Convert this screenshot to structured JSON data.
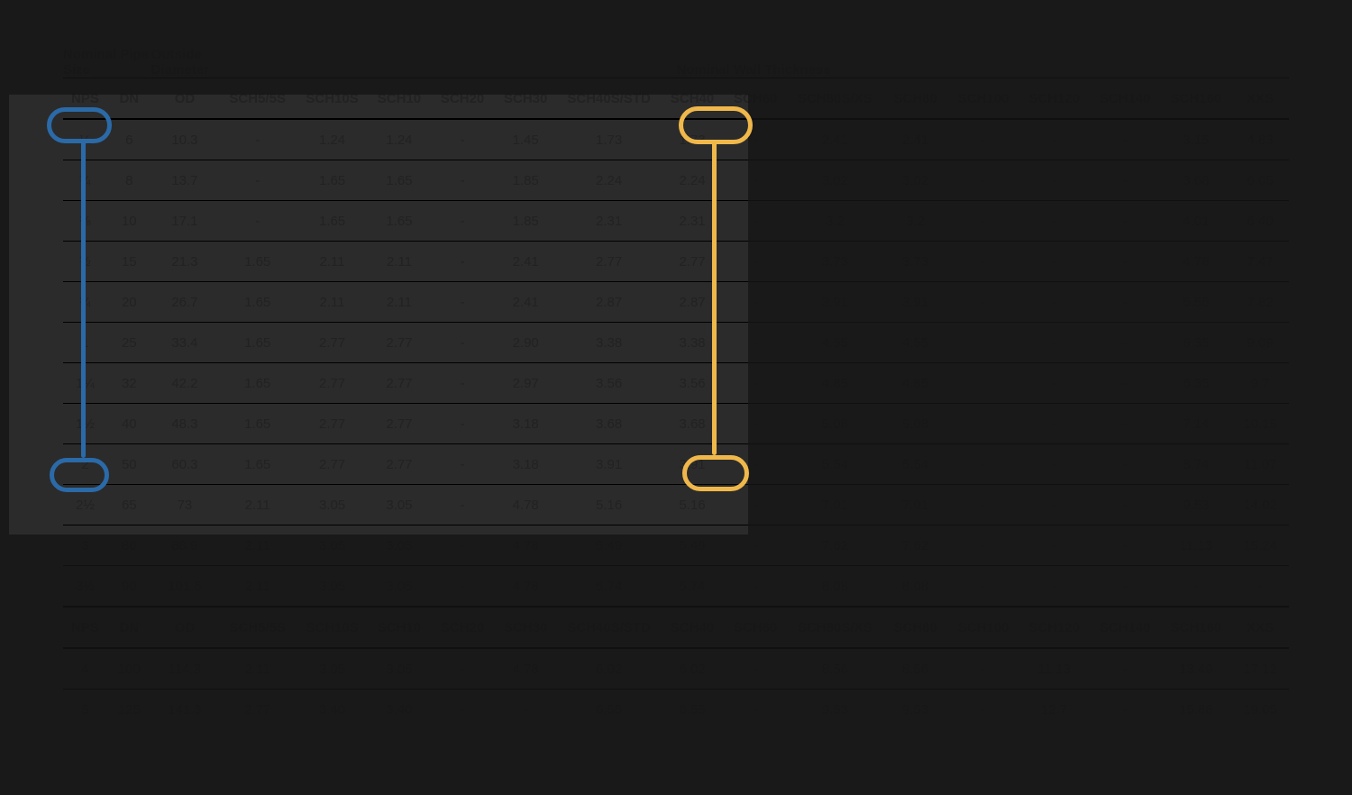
{
  "headers": {
    "group_nps": "Nominal Pipe Size",
    "group_od": "Outside Diameter",
    "group_thk": "Nominal Wall Thickness",
    "cols": [
      "NPS",
      "DN",
      "OD",
      "SCH5/5S",
      "SCH10S",
      "SCH10",
      "SCH20",
      "SCH30",
      "SCH40S/STD",
      "SCH40",
      "SCH60",
      "SCH80S/XS",
      "SCH80",
      "SCH100",
      "SCH120",
      "SCH140",
      "SCH160",
      "XXS"
    ]
  },
  "rows_top": [
    [
      "⅛",
      "6",
      "10.3",
      "-",
      "1.24",
      "1.24",
      "-",
      "1.45",
      "1.73",
      "1.73",
      "-",
      "2.41",
      "2.41",
      "-",
      "-",
      "-",
      "3.15",
      "4.83"
    ],
    [
      "¼",
      "8",
      "13.7",
      "-",
      "1.65",
      "1.65",
      "-",
      "1.85",
      "2.24",
      "2.24",
      "-",
      "3.02",
      "3.02",
      "-",
      "-",
      "-",
      "3.68",
      "6.05"
    ],
    [
      "⅜",
      "10",
      "17.1",
      "-",
      "1.65",
      "1.65",
      "-",
      "1.85",
      "2.31",
      "2.31",
      "-",
      "3.2",
      "3.2",
      "-",
      "-",
      "-",
      "4.01",
      "6.40"
    ],
    [
      "½",
      "15",
      "21.3",
      "1.65",
      "2.11",
      "2.11",
      "-",
      "2.41",
      "2.77",
      "2.77",
      "-",
      "3.73",
      "3.73",
      "-",
      "-",
      "-",
      "4.78",
      "7.47"
    ],
    [
      "¾",
      "20",
      "26.7",
      "1.65",
      "2.11",
      "2.11",
      "-",
      "2.41",
      "2.87",
      "2.87",
      "-",
      "3.91",
      "3.91",
      "-",
      "-",
      "-",
      "5.56",
      "7.82"
    ],
    [
      "1",
      "25",
      "33.4",
      "1.65",
      "2.77",
      "2.77",
      "-",
      "2.90",
      "3.38",
      "3.38",
      "-",
      "4.55",
      "4.55",
      "-",
      "-",
      "-",
      "6.35",
      "9.09"
    ],
    [
      "1¼",
      "32",
      "42.2",
      "1.65",
      "2.77",
      "2.77",
      "-",
      "2.97",
      "3.56",
      "3.56",
      "-",
      "4.85",
      "4.85",
      "-",
      "-",
      "-",
      "6.35",
      "9.7"
    ],
    [
      "1½",
      "40",
      "48.3",
      "1.65",
      "2.77",
      "2.77",
      "-",
      "3.18",
      "3.68",
      "3.68",
      "-",
      "5.08",
      "5.08",
      "-",
      "-",
      "-",
      "7.14",
      "10.15"
    ],
    [
      "2",
      "50",
      "60.3",
      "1.65",
      "2.77",
      "2.77",
      "-",
      "3.18",
      "3.91",
      "3.91",
      "-",
      "5.54",
      "5.54",
      "-",
      "-",
      "-",
      "8.74",
      "11.07"
    ],
    [
      "2½",
      "65",
      "73",
      "2.11",
      "3.05",
      "3.05",
      "-",
      "4.78",
      "5.16",
      "5.16",
      "-",
      "7.01",
      "7.01",
      "-",
      "-",
      "-",
      "9.53",
      "14.02"
    ],
    [
      "3",
      "80",
      "88.9",
      "2.11",
      "3.05",
      "3.05",
      "-",
      "4.78",
      "5.49",
      "5.49",
      "-",
      "7.62",
      "7.62",
      "-",
      "-",
      "-",
      "11.13",
      "15.24"
    ],
    [
      "3½",
      "90",
      "101.6",
      "2.11",
      "3.05",
      "3.05",
      "-",
      "4.78",
      "5.74",
      "5.74",
      "-",
      "8.08",
      "8.08",
      "-",
      "-",
      "-",
      "-",
      "-"
    ]
  ],
  "rows_bottom": [
    [
      "4",
      "100",
      "114.3",
      "2.11",
      "3.05",
      "3.05",
      "-",
      "4.78",
      "6.02",
      "6.02",
      "-",
      "8.56",
      "8.56",
      "-",
      "11.13",
      "-",
      "13.49",
      "17.12"
    ],
    [
      "5",
      "125",
      "141.3",
      "2.77",
      "3.40",
      "3.40",
      "-",
      "-",
      "6.55",
      "6.55",
      "-",
      "9.53",
      "9.53",
      "-",
      "12.7",
      "-",
      "15.88",
      "19.05"
    ]
  ],
  "highlight": {
    "nps_header": "NPS",
    "sch40_header": "SCH40",
    "nps_value": "2",
    "sch40_value": "3.91"
  },
  "annotation_colors": {
    "blue": "#2b6aa8",
    "gold": "#f0b84b"
  }
}
